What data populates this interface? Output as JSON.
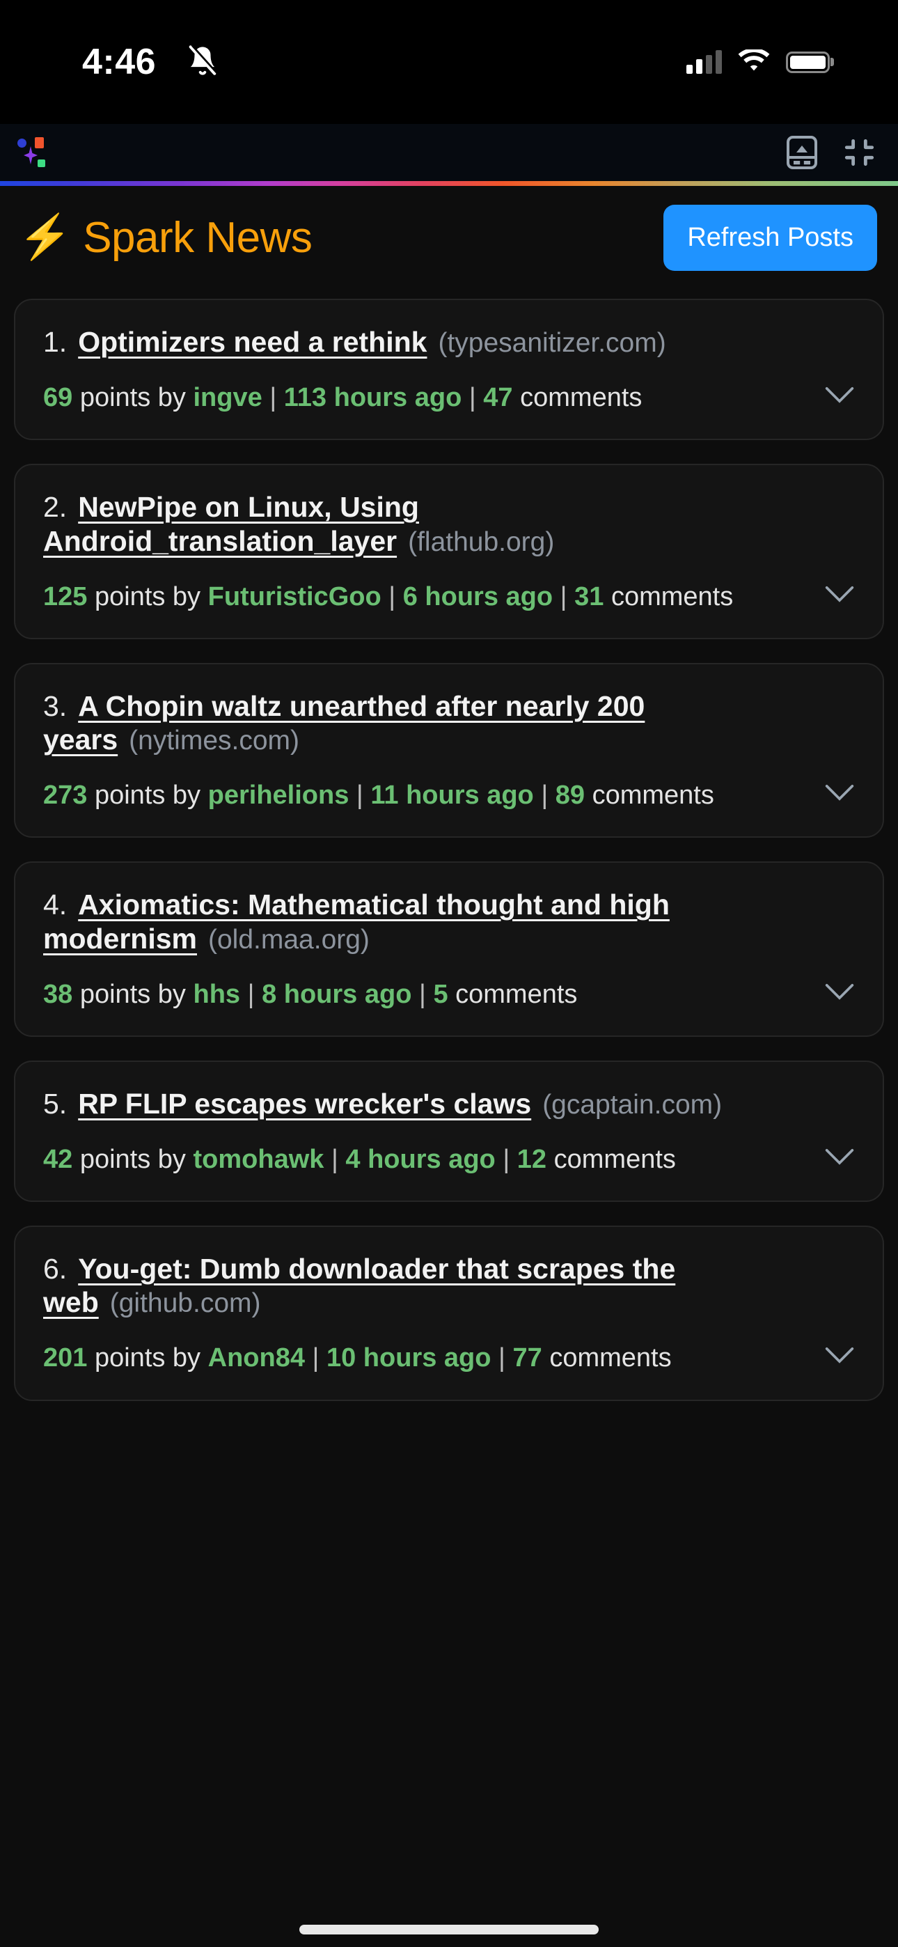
{
  "status_bar": {
    "time": "4:46",
    "bell_icon": "bell-slash-icon",
    "signal_icon": "cellular-signal-icon",
    "wifi_icon": "wifi-icon",
    "battery_icon": "battery-full-icon"
  },
  "browser_chrome": {
    "app_icon": "app-logo-icon",
    "keyboard_icon": "show-keyboard-icon",
    "collapse_icon": "collapse-fullscreen-icon"
  },
  "header": {
    "bolt_icon": "lightning-bolt-icon",
    "title": "Spark News",
    "title_color": "#f8a00b",
    "refresh_label": "Refresh Posts",
    "refresh_color": "#1f93ff"
  },
  "accent_colors": {
    "points_green": "#6bbf73",
    "domain_gray": "#8d949e",
    "card_bg": "#141414",
    "page_bg": "#0d0d0d"
  },
  "posts": [
    {
      "rank": "1.",
      "title": "Optimizers need a rethink",
      "domain": "(typesanitizer.com)",
      "points": "69",
      "points_label": "points by",
      "author": "ingve",
      "time": "113 hours ago",
      "comments": "47",
      "comments_label": "comments",
      "expand_icon": "chevron-down-icon"
    },
    {
      "rank": "2.",
      "title": "NewPipe on Linux, Using Android_translation_layer",
      "domain": "(flathub.org)",
      "points": "125",
      "points_label": "points by",
      "author": "FuturisticGoo",
      "time": "6 hours ago",
      "comments": "31",
      "comments_label": "comments",
      "expand_icon": "chevron-down-icon"
    },
    {
      "rank": "3.",
      "title": "A Chopin waltz unearthed after nearly 200 years",
      "domain": "(nytimes.com)",
      "points": "273",
      "points_label": "points by",
      "author": "perihelions",
      "time": "11 hours ago",
      "comments": "89",
      "comments_label": "comments",
      "expand_icon": "chevron-down-icon"
    },
    {
      "rank": "4.",
      "title": "Axiomatics: Mathematical thought and high modernism",
      "domain": "(old.maa.org)",
      "points": "38",
      "points_label": "points by",
      "author": "hhs",
      "time": "8 hours ago",
      "comments": "5",
      "comments_label": "comments",
      "expand_icon": "chevron-down-icon"
    },
    {
      "rank": "5.",
      "title": "RP FLIP escapes wrecker's claws",
      "domain": "(gcaptain.com)",
      "points": "42",
      "points_label": "points by",
      "author": "tomohawk",
      "time": "4 hours ago",
      "comments": "12",
      "comments_label": "comments",
      "expand_icon": "chevron-down-icon"
    },
    {
      "rank": "6.",
      "title": "You-get: Dumb downloader that scrapes the web",
      "domain": "(github.com)",
      "points": "201",
      "points_label": "points by",
      "author": "Anon84",
      "time": "10 hours ago",
      "comments": "77",
      "comments_label": "comments",
      "expand_icon": "chevron-down-icon"
    }
  ]
}
